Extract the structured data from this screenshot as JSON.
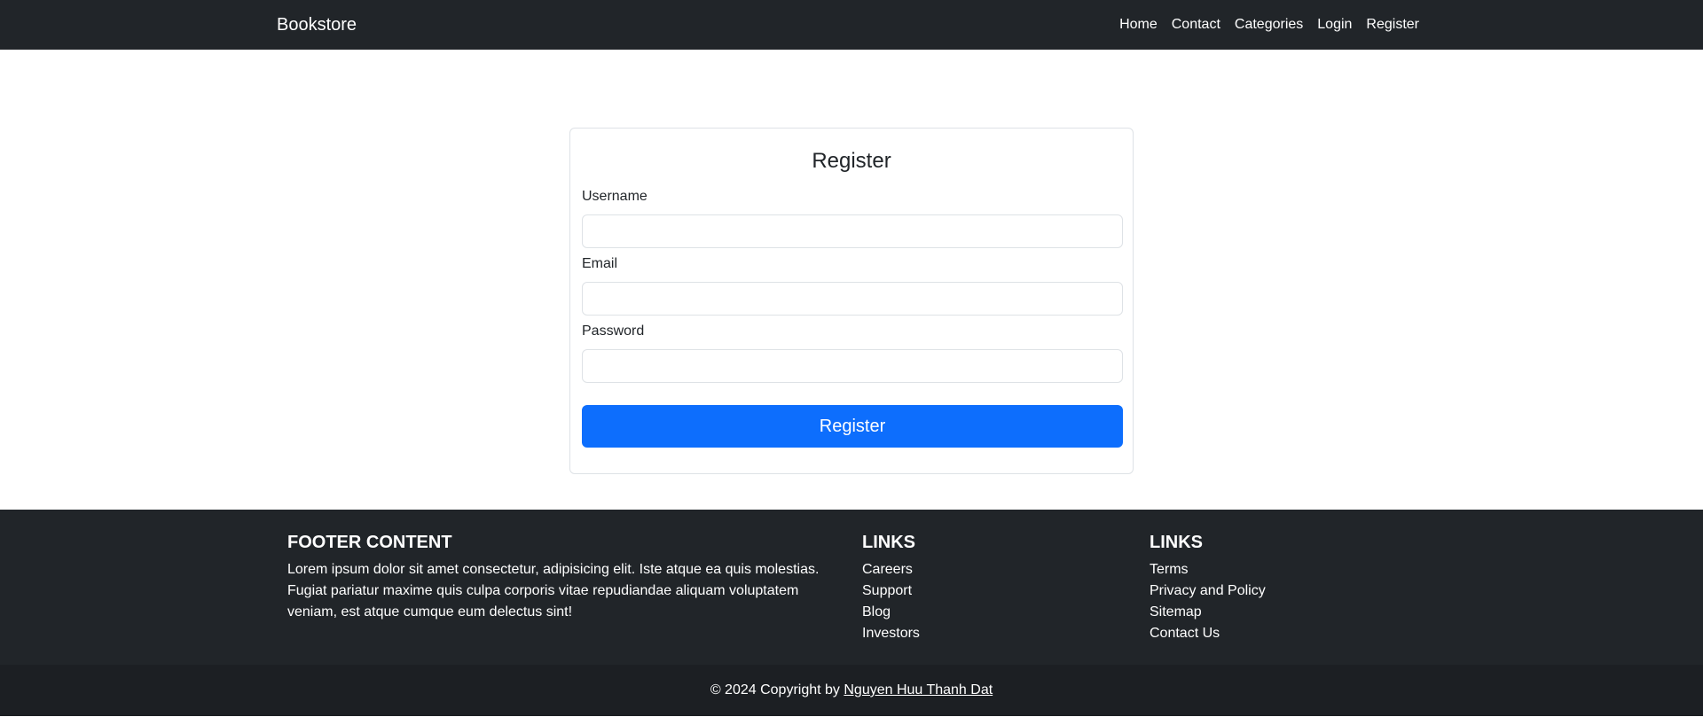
{
  "navbar": {
    "brand": "Bookstore",
    "links": [
      "Home",
      "Contact",
      "Categories",
      "Login",
      "Register"
    ]
  },
  "register_form": {
    "title": "Register",
    "fields": [
      {
        "label": "Username",
        "value": "",
        "placeholder": ""
      },
      {
        "label": "Email",
        "value": "",
        "placeholder": ""
      },
      {
        "label": "Password",
        "value": "",
        "placeholder": ""
      }
    ],
    "submit_label": "Register"
  },
  "footer": {
    "about": {
      "heading": "FOOTER CONTENT",
      "text": "Lorem ipsum dolor sit amet consectetur, adipisicing elit. Iste atque ea quis molestias. Fugiat pariatur maxime quis culpa corporis vitae repudiandae aliquam voluptatem veniam, est atque cumque eum delectus sint!"
    },
    "links_1": {
      "heading": "LINKS",
      "items": [
        "Careers",
        "Support",
        "Blog",
        "Investors"
      ]
    },
    "links_2": {
      "heading": "LINKS",
      "items": [
        "Terms",
        "Privacy and Policy",
        "Sitemap",
        "Contact Us"
      ]
    }
  },
  "copyright": {
    "prefix": "© 2024 Copyright by",
    "author": "Nguyen Huu Thanh Dat"
  },
  "colors": {
    "navbar_bg": "#212529",
    "primary_button": "#0d6efd",
    "footer_bg": "#212529",
    "copyright_bg": "#1c1f23"
  }
}
